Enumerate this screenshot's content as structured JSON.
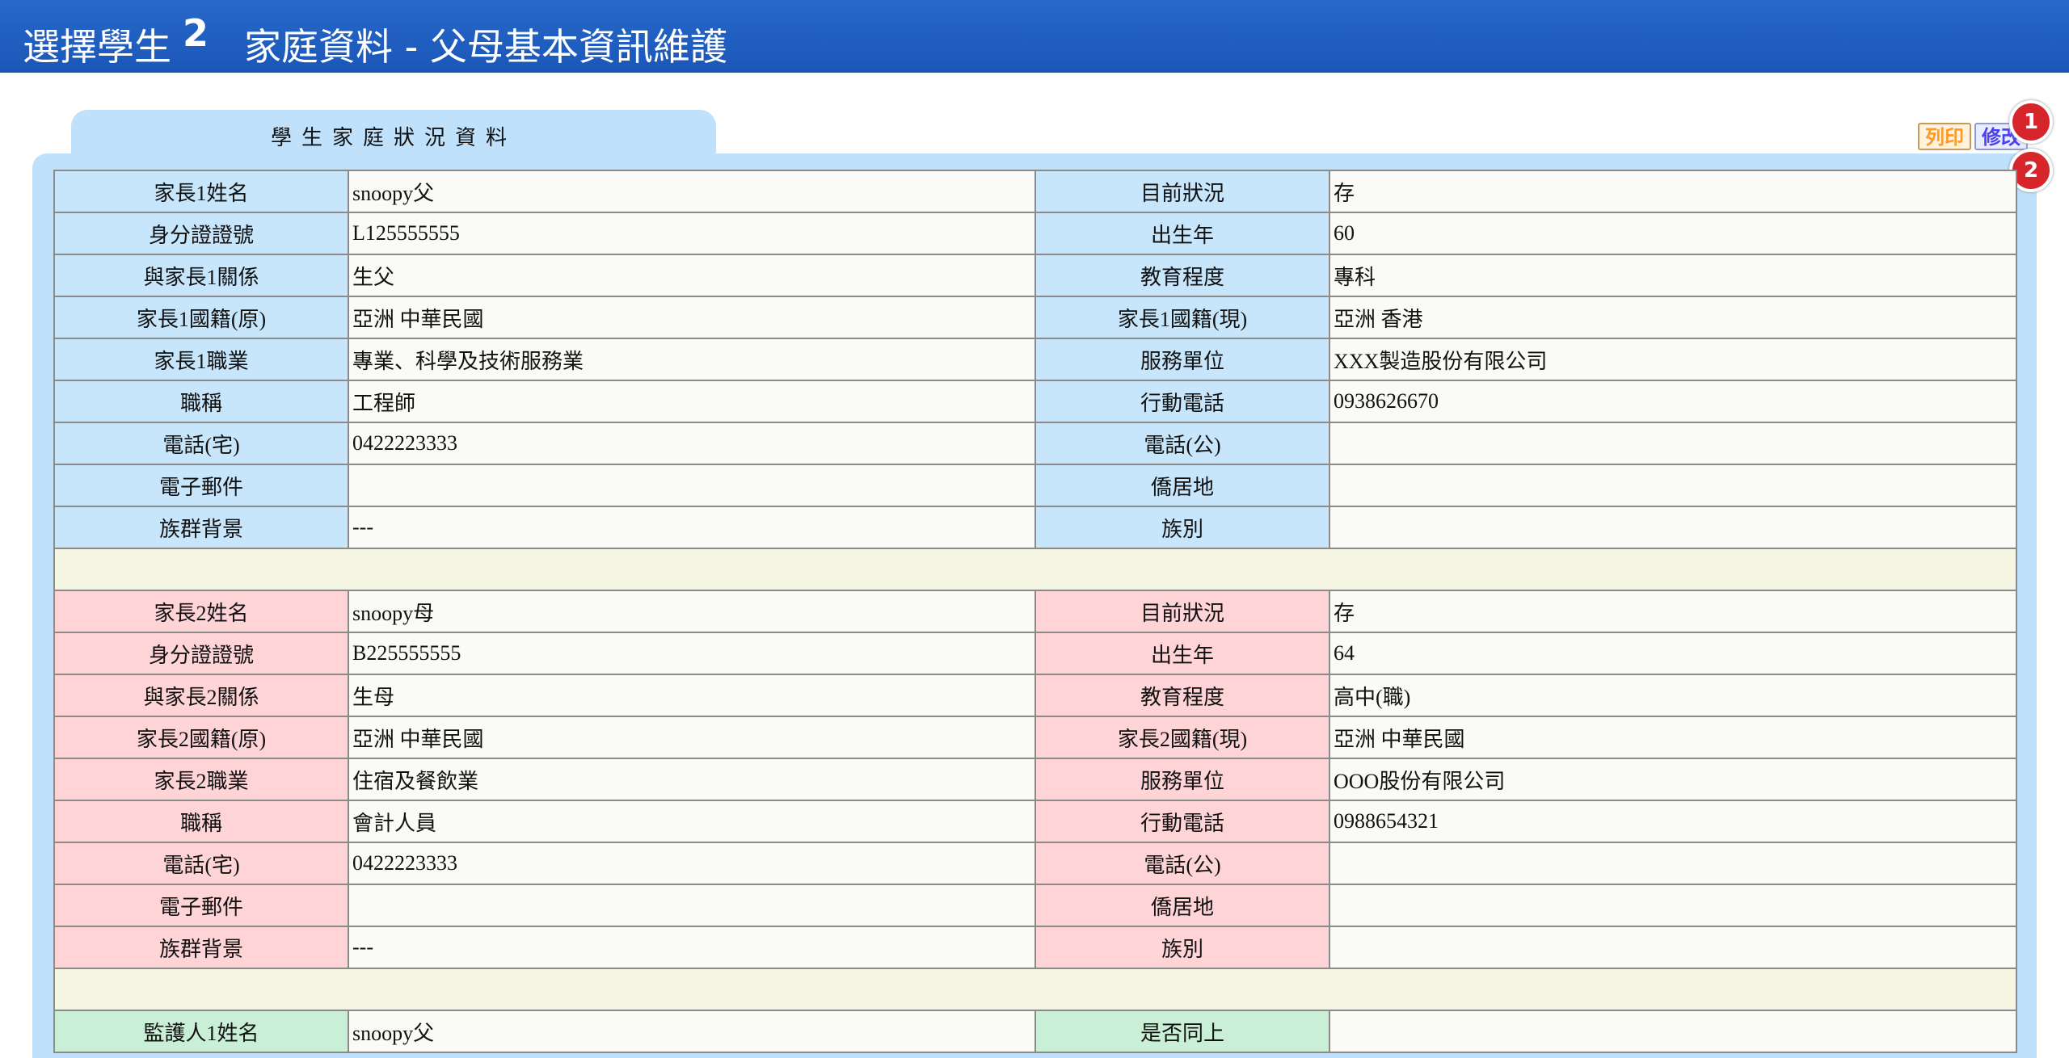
{
  "header": {
    "select_label": "選擇學生",
    "step": "2",
    "title": "家庭資料 - 父母基本資訊維護"
  },
  "tab_label": "學生家庭狀況資料",
  "buttons": {
    "print": "列印",
    "edit": "修改"
  },
  "markers": [
    "1",
    "2"
  ],
  "parent1": [
    {
      "l1": "家長1姓名",
      "v1": "snoopy父",
      "l2": "目前狀況",
      "v2": "存"
    },
    {
      "l1": "身分證證號",
      "v1": "L125555555",
      "l2": "出生年",
      "v2": "60"
    },
    {
      "l1": "與家長1關係",
      "v1": "生父",
      "l2": "教育程度",
      "v2": "專科"
    },
    {
      "l1": "家長1國籍(原)",
      "v1": "亞洲 中華民國",
      "l2": "家長1國籍(現)",
      "v2": "亞洲 香港"
    },
    {
      "l1": "家長1職業",
      "v1": "專業、科學及技術服務業",
      "l2": "服務單位",
      "v2": "XXX製造股份有限公司"
    },
    {
      "l1": "職稱",
      "v1": "工程師",
      "l2": "行動電話",
      "v2": "0938626670"
    },
    {
      "l1": "電話(宅)",
      "v1": "0422223333",
      "l2": "電話(公)",
      "v2": ""
    },
    {
      "l1": "電子郵件",
      "v1": "",
      "l2": "僑居地",
      "v2": ""
    },
    {
      "l1": "族群背景",
      "v1": "---",
      "l2": "族別",
      "v2": ""
    }
  ],
  "parent2": [
    {
      "l1": "家長2姓名",
      "v1": "snoopy母",
      "l2": "目前狀況",
      "v2": "存"
    },
    {
      "l1": "身分證證號",
      "v1": "B225555555",
      "l2": "出生年",
      "v2": "64"
    },
    {
      "l1": "與家長2關係",
      "v1": "生母",
      "l2": "教育程度",
      "v2": "高中(職)"
    },
    {
      "l1": "家長2國籍(原)",
      "v1": "亞洲 中華民國",
      "l2": "家長2國籍(現)",
      "v2": "亞洲 中華民國"
    },
    {
      "l1": "家長2職業",
      "v1": "住宿及餐飲業",
      "l2": "服務單位",
      "v2": "OOO股份有限公司"
    },
    {
      "l1": "職稱",
      "v1": "會計人員",
      "l2": "行動電話",
      "v2": "0988654321"
    },
    {
      "l1": "電話(宅)",
      "v1": "0422223333",
      "l2": "電話(公)",
      "v2": ""
    },
    {
      "l1": "電子郵件",
      "v1": "",
      "l2": "僑居地",
      "v2": ""
    },
    {
      "l1": "族群背景",
      "v1": "---",
      "l2": "族別",
      "v2": ""
    }
  ],
  "guardian1": [
    {
      "l1": "監護人1姓名",
      "v1": "snoopy父",
      "l2": "是否同上",
      "v2": ""
    }
  ]
}
